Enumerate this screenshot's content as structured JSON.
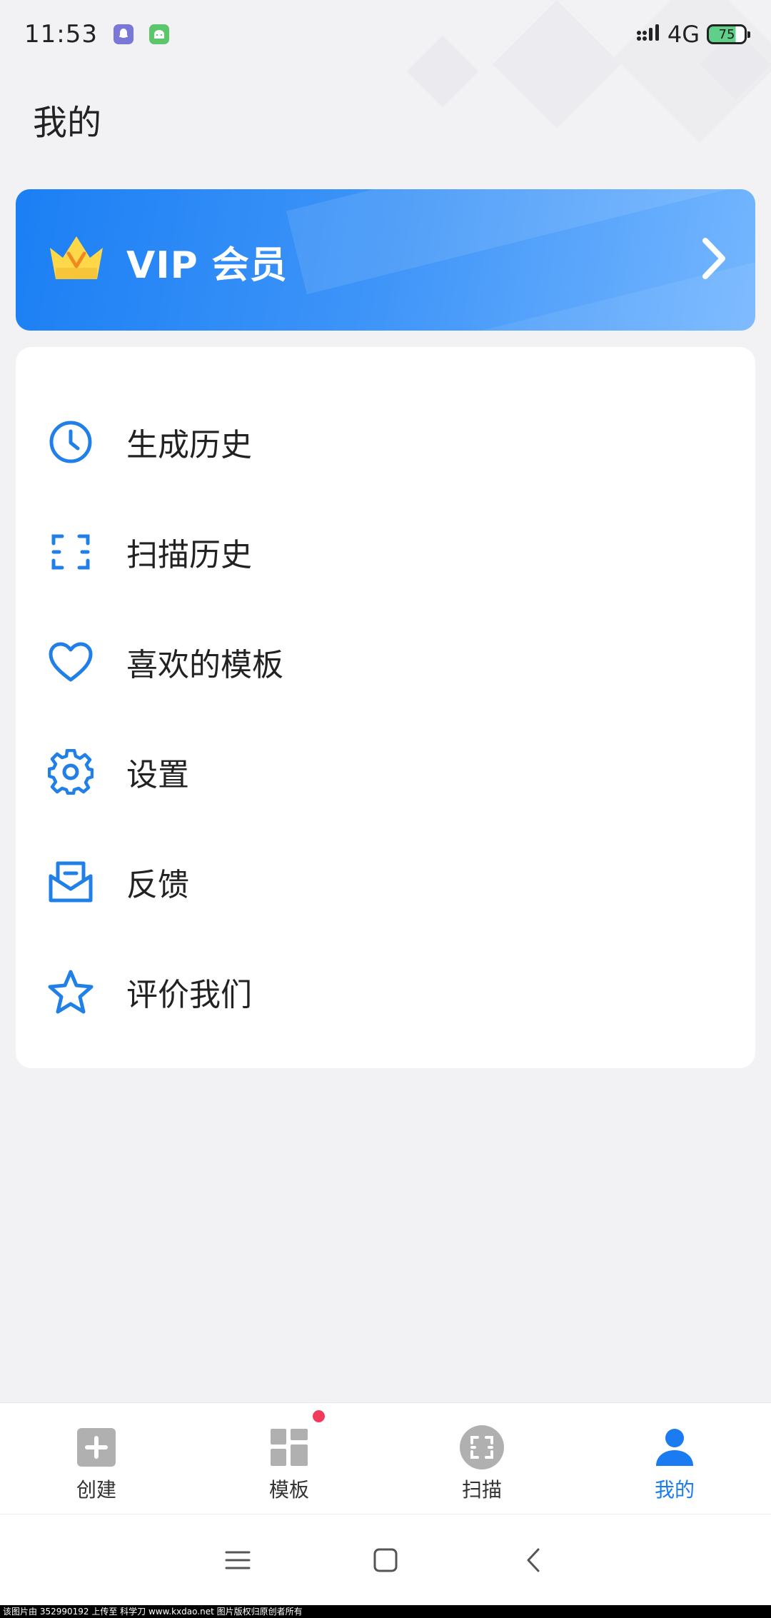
{
  "status_bar": {
    "time": "11:53",
    "network": "4G",
    "battery": "75"
  },
  "page": {
    "title": "我的"
  },
  "vip": {
    "label": "VIP 会员"
  },
  "menu": {
    "items": [
      {
        "label": "生成历史",
        "icon": "clock-icon"
      },
      {
        "label": "扫描历史",
        "icon": "scan-icon"
      },
      {
        "label": "喜欢的模板",
        "icon": "heart-icon"
      },
      {
        "label": "设置",
        "icon": "gear-icon"
      },
      {
        "label": "反馈",
        "icon": "mail-icon"
      },
      {
        "label": "评价我们",
        "icon": "star-icon"
      }
    ]
  },
  "tabbar": {
    "tabs": [
      {
        "label": "创建",
        "icon": "plus-square-icon",
        "active": false
      },
      {
        "label": "模板",
        "icon": "grid-icon",
        "active": false,
        "badge": true
      },
      {
        "label": "扫描",
        "icon": "scan-circle-icon",
        "active": false
      },
      {
        "label": "我的",
        "icon": "person-icon",
        "active": true
      }
    ]
  },
  "colors": {
    "accent": "#1a7cf0",
    "icon_blue": "#2080e8",
    "badge": "#f23a5c",
    "inactive_icon": "#b0b0b0"
  },
  "watermark": {
    "text": "该图片由 352990192 上传至 科学刀 www.kxdao.net 图片版权归原创者所有"
  }
}
